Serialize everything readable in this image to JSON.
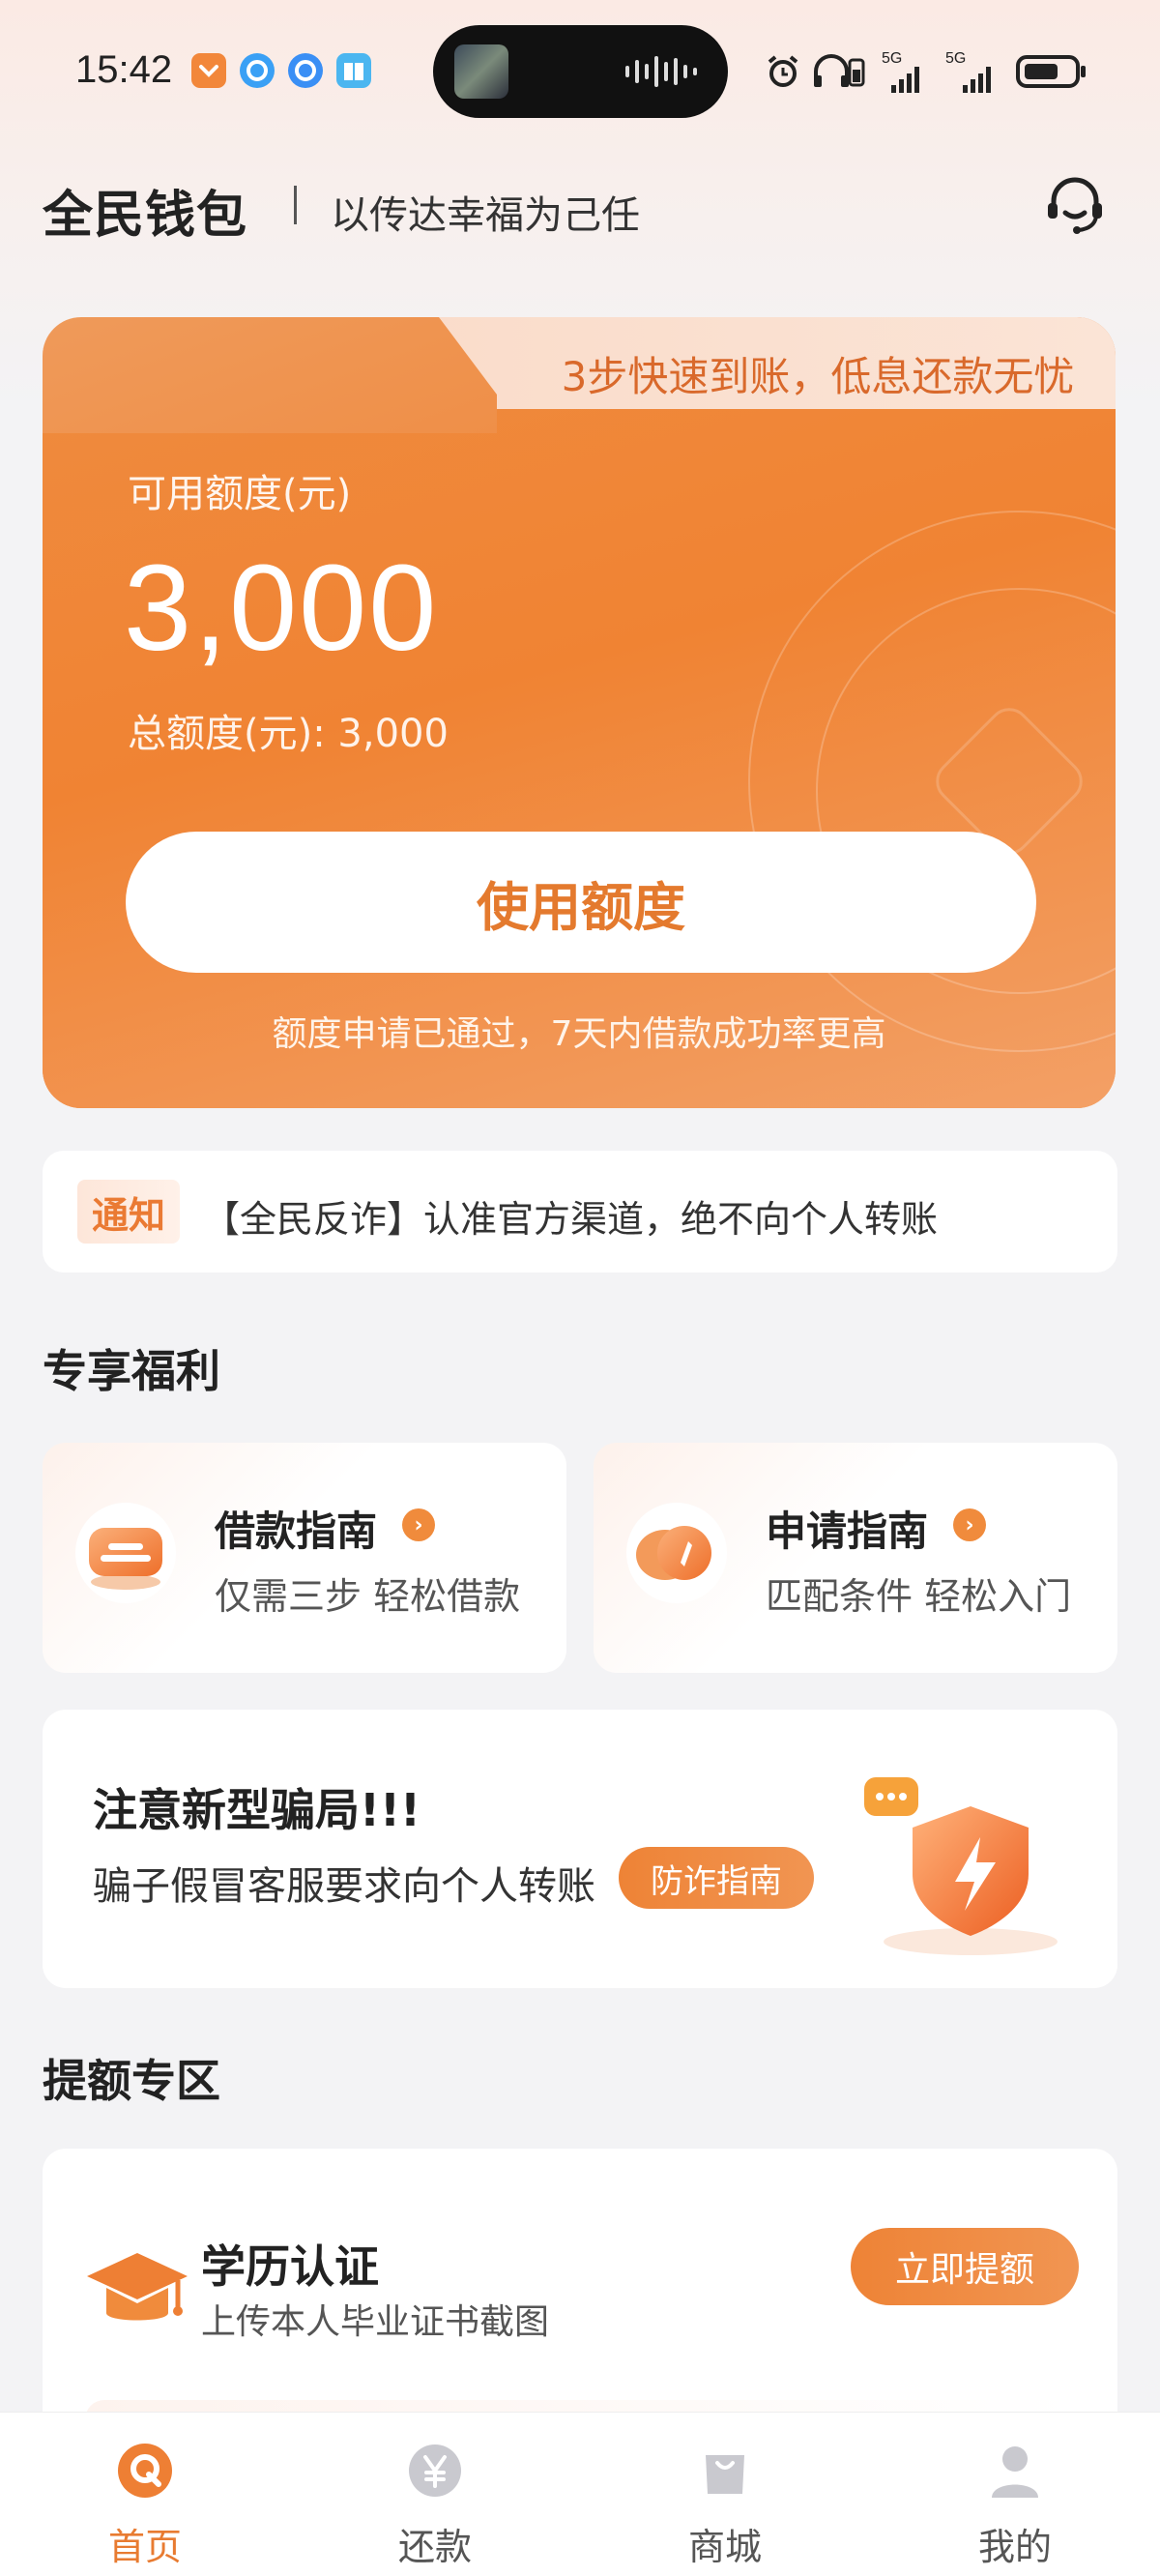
{
  "status_bar": {
    "time": "15:42",
    "network_1": "5G",
    "network_2": "5G",
    "icons": [
      "wallet-app-icon",
      "browser-icon",
      "browser-icon",
      "book-icon",
      "alarm-icon",
      "headphones-icon",
      "battery-icon"
    ]
  },
  "header": {
    "brand": "全民钱包",
    "slogan": "以传达幸福为己任",
    "support_icon": "headset-icon"
  },
  "credit_card": {
    "promo": "3步快速到账，低息还款无忧",
    "available_label": "可用额度(元)",
    "available_amount": "3,000",
    "total_label": "总额度(元): 3,000",
    "use_button": "使用额度",
    "note": "额度申请已通过，7天内借款成功率更高"
  },
  "notice": {
    "tag": "通知",
    "text": "【全民反诈】认准官方渠道，绝不向个人转账"
  },
  "benefits": {
    "title": "专享福利",
    "items": [
      {
        "title": "借款指南",
        "subtitle": "仅需三步 轻松借款",
        "icon": "wallet-card-icon"
      },
      {
        "title": "申请指南",
        "subtitle": "匹配条件 轻松入门",
        "icon": "compass-icon"
      }
    ]
  },
  "scam_alert": {
    "title": "注意新型骗局!!!",
    "text": "骗子假冒客服要求向个人转账",
    "button": "防诈指南"
  },
  "boost": {
    "title": "提额专区",
    "items": [
      {
        "title": "学历认证",
        "subtitle": "上传本人毕业证书截图",
        "button": "立即提额",
        "icon": "graduation-cap-icon"
      }
    ]
  },
  "bottom_nav": {
    "items": [
      {
        "label": "首页",
        "icon": "home-icon",
        "active": true
      },
      {
        "label": "还款",
        "icon": "yen-coin-icon",
        "active": false
      },
      {
        "label": "商城",
        "icon": "shopping-bag-icon",
        "active": false
      },
      {
        "label": "我的",
        "icon": "user-icon",
        "active": false
      }
    ]
  },
  "colors": {
    "accent": "#F08B3C",
    "card_gradient_start": "#EF8A3D",
    "card_gradient_end": "#F3A066",
    "background": "#F3F3F5"
  }
}
